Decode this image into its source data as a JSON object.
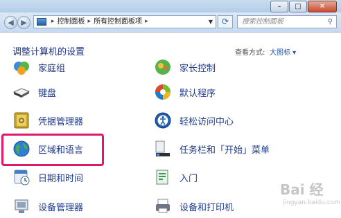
{
  "window": {
    "min_label": "–",
    "max_label": "□",
    "close_label": "✕"
  },
  "toolbar": {
    "breadcrumb": [
      "控制面板",
      "所有控制面板项"
    ],
    "search_placeholder": "搜索控制面板"
  },
  "header": {
    "title": "调整计算机的设置",
    "view_by_label": "查看方式:",
    "view_by_value": "大图标 ▾"
  },
  "items": {
    "homegroup": "家庭组",
    "parental": "家长控制",
    "keyboard": "键盘",
    "default_programs": "默认程序",
    "credential_manager": "凭据管理器",
    "ease_of_access": "轻松访问中心",
    "region_language": "区域和语言",
    "taskbar_start": "任务栏和「开始」菜单",
    "date_time": "日期和时间",
    "getting_started": "入门",
    "device_manager": "设备管理器",
    "devices_printers": "设备和打印机"
  }
}
